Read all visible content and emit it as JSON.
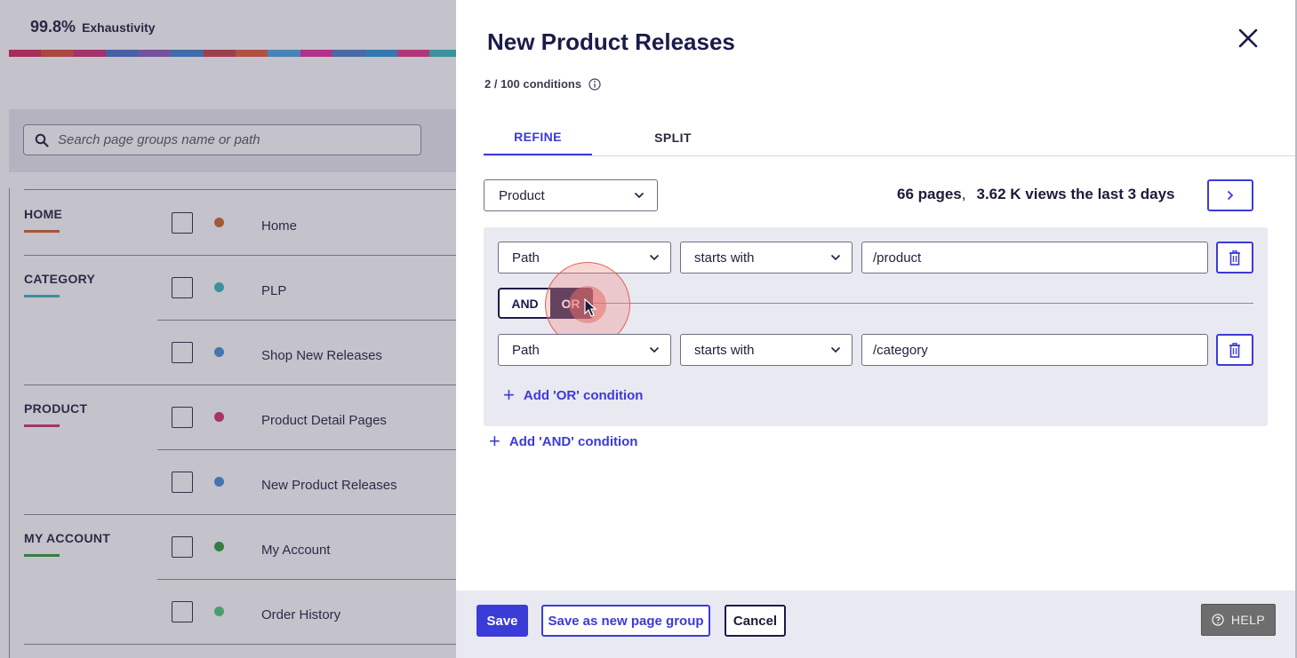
{
  "background": {
    "exhaustivity_value": "99.8%",
    "exhaustivity_label": "Exhaustivity",
    "colorbar": [
      "#d4265b",
      "#d74a36",
      "#cf2a73",
      "#4b6fc9",
      "#8a5ab8",
      "#3f7fd0",
      "#c73d48",
      "#e05a3a",
      "#4aa3e0",
      "#e32ca0",
      "#4a7ec8",
      "#2a93d6",
      "#e5338a",
      "#36b7c0"
    ],
    "search_placeholder": "Search page groups name or path",
    "groups": [
      {
        "title": "HOME",
        "color": "#d2622e"
      },
      {
        "title": "CATEGORY",
        "color": "#37b6c0"
      },
      {
        "title": "PRODUCT",
        "color": "#d0306a"
      },
      {
        "title": "MY ACCOUNT",
        "color": "#2e9a3a"
      }
    ],
    "rows": [
      {
        "label": "Home",
        "color": "#d2622e"
      },
      {
        "label": "PLP",
        "color": "#37b6c0"
      },
      {
        "label": "Shop New Releases",
        "color": "#3e8fd6"
      },
      {
        "label": "Product Detail Pages",
        "color": "#d0306a"
      },
      {
        "label": "New Product Releases",
        "color": "#3e8fd6"
      },
      {
        "label": "My Account",
        "color": "#2e9a3a"
      },
      {
        "label": "Order History",
        "color": "#4ccb7b"
      }
    ]
  },
  "panel": {
    "title": "New Product Releases",
    "conditions_count": "2 / 100 conditions",
    "tabs": [
      {
        "label": "REFINE",
        "active": true
      },
      {
        "label": "SPLIT",
        "active": false
      }
    ],
    "category_select": "Product",
    "stats": {
      "pages": "66 pages",
      "separator": ",",
      "views": "3.62 K views the last 3 days"
    },
    "conditions": [
      {
        "field": "Path",
        "operator": "starts with",
        "value": "/product"
      },
      {
        "field": "Path",
        "operator": "starts with",
        "value": "/category"
      }
    ],
    "logic": {
      "and_label": "AND",
      "or_label": "OR",
      "selected": "OR"
    },
    "add_or_label": "Add 'OR' condition",
    "add_and_label": "Add 'AND' condition",
    "footer": {
      "save_label": "Save",
      "save_new_label": "Save as new page group",
      "cancel_label": "Cancel",
      "help_label": "HELP"
    }
  },
  "colors": {
    "accent": "#3b3bd8",
    "navy": "#1b1b4b",
    "panel_bg": "#e9e9f1",
    "help_bg": "#6e6e6e"
  }
}
